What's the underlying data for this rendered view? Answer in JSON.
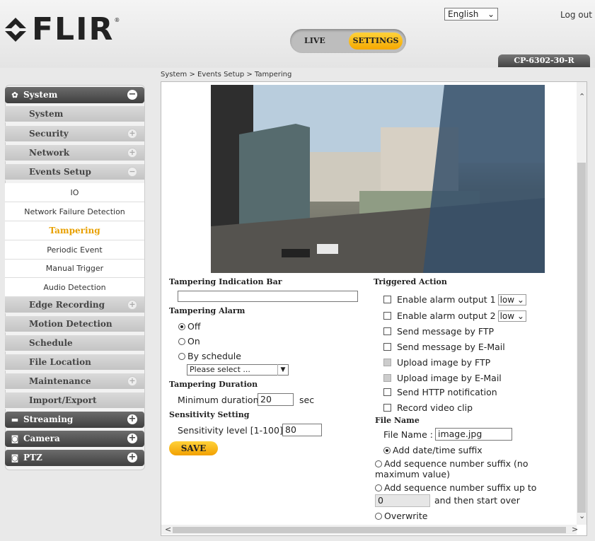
{
  "header": {
    "logo_text": "FLIR",
    "language": "English",
    "logout": "Log out",
    "tab_live": "LIVE",
    "tab_settings": "SETTINGS",
    "model": "CP-6302-30-R"
  },
  "breadcrumb": "System > Events Setup > Tampering",
  "sidebar": {
    "items": [
      {
        "label": "System",
        "type": "main",
        "icon": "gear-icon",
        "control": "minus"
      },
      {
        "label": "System",
        "type": "sub"
      },
      {
        "label": "Security",
        "type": "sub",
        "control": "plus"
      },
      {
        "label": "Network",
        "type": "sub",
        "control": "plus"
      },
      {
        "label": "Events Setup",
        "type": "sub",
        "control": "minus"
      },
      {
        "label": "IO",
        "type": "leaf"
      },
      {
        "label": "Network Failure Detection",
        "type": "leaf"
      },
      {
        "label": "Tampering",
        "type": "leaf",
        "active": true
      },
      {
        "label": "Periodic Event",
        "type": "leaf"
      },
      {
        "label": "Manual Trigger",
        "type": "leaf"
      },
      {
        "label": "Audio Detection",
        "type": "leaf"
      },
      {
        "label": "Edge Recording",
        "type": "sub",
        "control": "plus"
      },
      {
        "label": "Motion Detection",
        "type": "sub"
      },
      {
        "label": "Schedule",
        "type": "sub"
      },
      {
        "label": "File Location",
        "type": "sub"
      },
      {
        "label": "Maintenance",
        "type": "sub",
        "control": "plus"
      },
      {
        "label": "Import/Export",
        "type": "sub"
      },
      {
        "label": "Streaming",
        "type": "main",
        "icon": "monitor-icon",
        "control": "plus"
      },
      {
        "label": "Camera",
        "type": "main",
        "icon": "camera-icon",
        "control": "plus"
      },
      {
        "label": "PTZ",
        "type": "main",
        "icon": "camera-icon",
        "control": "plus"
      }
    ]
  },
  "left": {
    "bar_title": "Tampering Indication Bar",
    "alarm_title": "Tampering Alarm",
    "alarm_off": "Off",
    "alarm_on": "On",
    "alarm_schedule": "By schedule",
    "schedule_select": "Please select ...",
    "duration_title": "Tampering Duration",
    "duration_label": "Minimum duration",
    "duration_value": "20",
    "duration_unit": "sec",
    "sensitivity_title": "Sensitivity Setting",
    "sensitivity_label": "Sensitivity level [1-100]",
    "sensitivity_value": "80",
    "save": "SAVE"
  },
  "right": {
    "title": "Triggered Action",
    "alarm1": "Enable alarm output 1",
    "alarm1_level": "low",
    "alarm2": "Enable alarm output 2",
    "alarm2_level": "low",
    "ftp_msg": "Send message by FTP",
    "email_msg": "Send message by E-Mail",
    "ftp_img": "Upload image by FTP",
    "email_img": "Upload image by E-Mail",
    "http": "Send HTTP notification",
    "record": "Record video clip",
    "filename_title": "File Name",
    "filename_label": "File Name :",
    "filename_value": "image.jpg",
    "opt_datetime": "Add date/time suffix",
    "opt_seq_nomax_1": "Add sequence number suffix (no",
    "opt_seq_nomax_2": "maximum value)",
    "opt_seq_upto": "Add sequence number suffix up to",
    "seq_value": "0",
    "seq_after": "and then start over",
    "opt_overwrite": "Overwrite"
  }
}
